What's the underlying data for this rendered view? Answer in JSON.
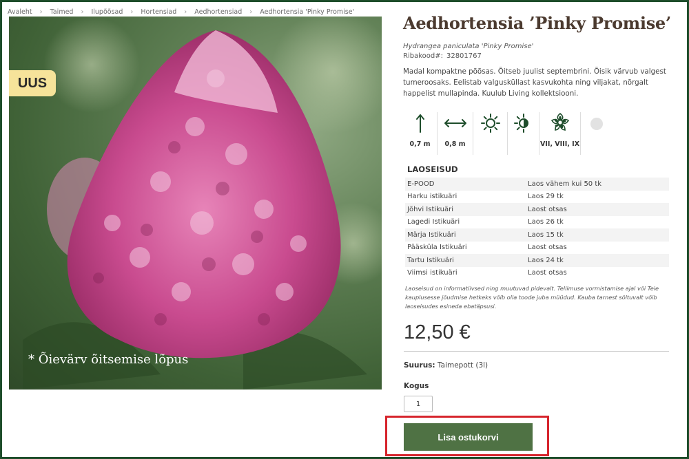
{
  "breadcrumb": [
    "Avaleht",
    "Taimed",
    "Ilupõõsad",
    "Hortensiad",
    "Aedhortensiad",
    "Aedhortensia 'Pinky Promise'"
  ],
  "image": {
    "badge": "UUS",
    "caption": "* Õievärv õitsemise lõpus"
  },
  "product": {
    "title": "Aedhortensia ’Pinky Promise’",
    "latin": "Hydrangea paniculata 'Pinky Promise'",
    "sku_label": "Ribakood#:",
    "sku_value": "32801767",
    "description": "Madal kompaktne põõsas. Õitseb juulist septembrini. Õisik värvub valgest tumeroosaks. Eelistab valgusküllast kasvukohta ning viljakat, nõrgalt happelist mullapinda. Kuulub Living kollektsiooni."
  },
  "attributes": {
    "height": "0,7 m",
    "width": "0,8 m",
    "bloom": "VII, VIII, IX",
    "icons": [
      "arrow-up-down-icon",
      "arrow-left-right-icon",
      "sun-icon",
      "half-shade-icon",
      "flower-icon",
      "color-dot-icon"
    ]
  },
  "stock": {
    "heading": "LAOSEISUD",
    "rows": [
      {
        "location": "E-POOD",
        "status": "Laos vähem kui 50 tk"
      },
      {
        "location": "Harku istikuäri",
        "status": "Laos 29 tk"
      },
      {
        "location": "Jõhvi Istikuäri",
        "status": "Laost otsas"
      },
      {
        "location": "Lagedi Istikuäri",
        "status": "Laos 26 tk"
      },
      {
        "location": "Märja Istikuäri",
        "status": "Laos 15 tk"
      },
      {
        "location": "Pääsküla Istikuäri",
        "status": "Laost otsas"
      },
      {
        "location": "Tartu Istikuäri",
        "status": "Laos 24 tk"
      },
      {
        "location": "Viimsi istikuäri",
        "status": "Laost otsas"
      }
    ],
    "note": "Laoseisud on informatiivsed ning muutuvad pidevalt. Tellimuse vormistamise ajal või Teie kauplusesse jõudmise hetkeks võib olla toode juba müüdud. Kauba tarnest sõltuvalt võib laoseisudes esineda ebatäpsusi."
  },
  "purchase": {
    "price": "12,50 €",
    "size_label": "Suurus:",
    "size_value": "Taimepott (3l)",
    "qty_label": "Kogus",
    "qty_value": "1",
    "cart_button": "Lisa ostukorvi"
  },
  "colors": {
    "brand_green": "#4f7244",
    "frame": "#1e4d2b",
    "title_brown": "#4b3a2f",
    "badge": "#f6e39a",
    "highlight": "#d6242c"
  }
}
